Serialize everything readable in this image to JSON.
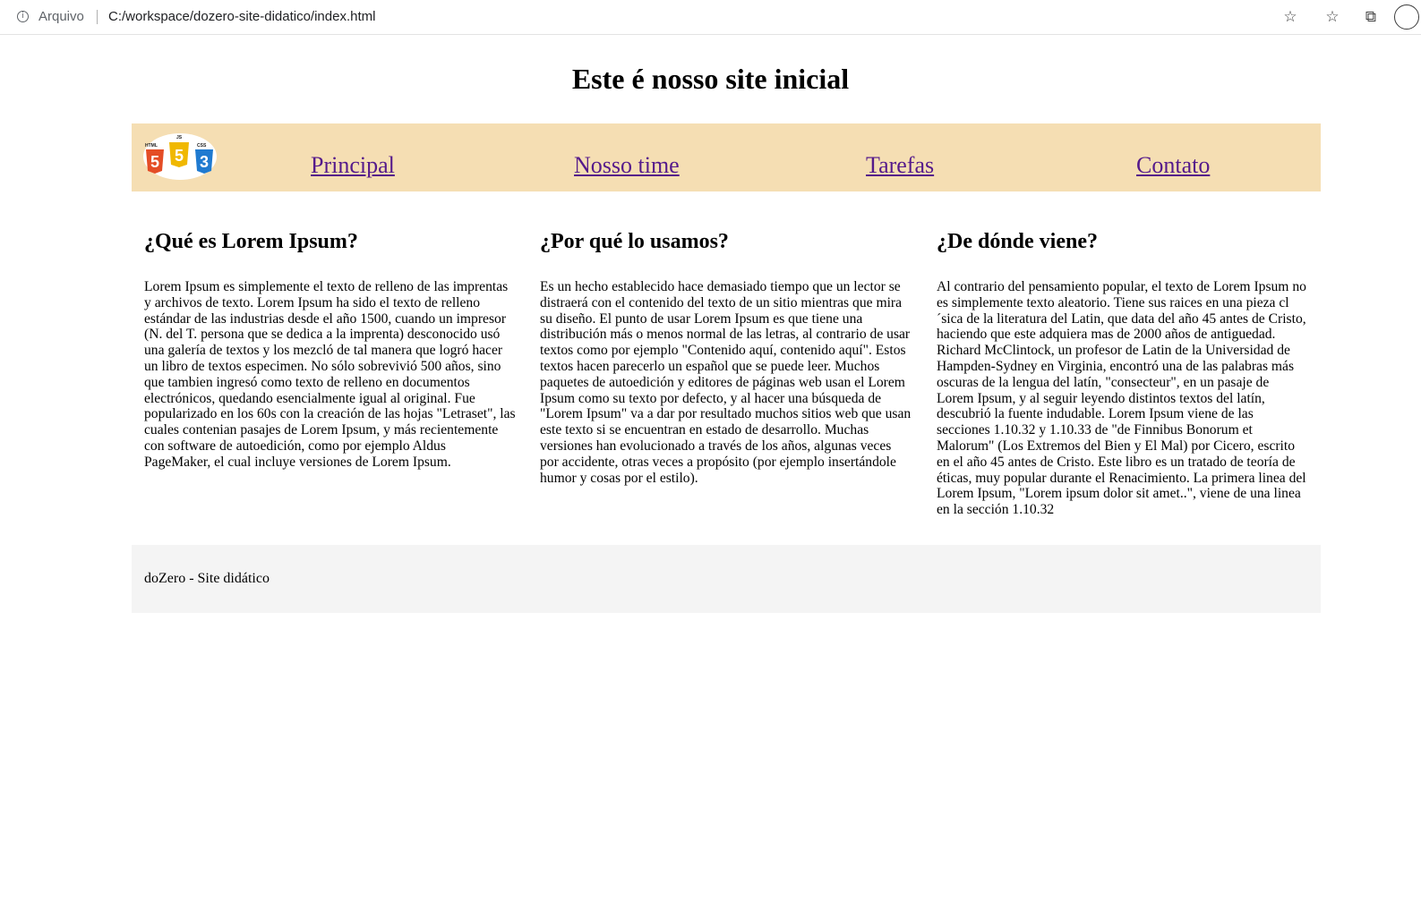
{
  "browser": {
    "protocol_label": "Arquivo",
    "url": "C:/workspace/dozero-site-didatico/index.html",
    "icons": {
      "info": "info-icon",
      "add_favorite": "star-add-icon",
      "favorites": "favorites-icon",
      "collections": "collections-icon",
      "profile": "profile-icon"
    }
  },
  "page": {
    "title": "Este é nosso site inicial",
    "logo": {
      "html": "HTML",
      "js": "JS",
      "css": "CSS",
      "html_num": "5",
      "js_num": "5",
      "css_num": "3"
    },
    "nav": [
      "Principal",
      "Nosso time",
      "Tarefas",
      "Contato"
    ],
    "colors": {
      "nav_bg": "#f5deb3",
      "footer_bg": "#f4f4f4",
      "link": "#551a8b"
    },
    "columns": [
      {
        "heading": "¿Qué es Lorem Ipsum?",
        "text": "Lorem Ipsum es simplemente el texto de relleno de las imprentas y archivos de texto. Lorem Ipsum ha sido el texto de relleno estándar de las industrias desde el año 1500, cuando un impresor (N. del T. persona que se dedica a la imprenta) desconocido usó una galería de textos y los mezcló de tal manera que logró hacer un libro de textos especimen. No sólo sobrevivió 500 años, sino que tambien ingresó como texto de relleno en documentos electrónicos, quedando esencialmente igual al original. Fue popularizado en los 60s con la creación de las hojas \"Letraset\", las cuales contenian pasajes de Lorem Ipsum, y más recientemente con software de autoedición, como por ejemplo Aldus PageMaker, el cual incluye versiones de Lorem Ipsum."
      },
      {
        "heading": "¿Por qué lo usamos?",
        "text": "Es un hecho establecido hace demasiado tiempo que un lector se distraerá con el contenido del texto de un sitio mientras que mira su diseño. El punto de usar Lorem Ipsum es que tiene una distribución más o menos normal de las letras, al contrario de usar textos como por ejemplo \"Contenido aquí, contenido aquí\". Estos textos hacen parecerlo un español que se puede leer. Muchos paquetes de autoedición y editores de páginas web usan el Lorem Ipsum como su texto por defecto, y al hacer una búsqueda de \"Lorem Ipsum\" va a dar por resultado muchos sitios web que usan este texto si se encuentran en estado de desarrollo. Muchas versiones han evolucionado a través de los años, algunas veces por accidente, otras veces a propósito (por ejemplo insertándole humor y cosas por el estilo)."
      },
      {
        "heading": "¿De dónde viene?",
        "text": "Al contrario del pensamiento popular, el texto de Lorem Ipsum no es simplemente texto aleatorio. Tiene sus raices en una pieza cl´sica de la literatura del Latin, que data del año 45 antes de Cristo, haciendo que este adquiera mas de 2000 años de antiguedad. Richard McClintock, un profesor de Latin de la Universidad de Hampden-Sydney en Virginia, encontró una de las palabras más oscuras de la lengua del latín, \"consecteur\", en un pasaje de Lorem Ipsum, y al seguir leyendo distintos textos del latín, descubrió la fuente indudable. Lorem Ipsum viene de las secciones 1.10.32 y 1.10.33 de \"de Finnibus Bonorum et Malorum\" (Los Extremos del Bien y El Mal) por Cicero, escrito en el año 45 antes de Cristo. Este libro es un tratado de teoría de éticas, muy popular durante el Renacimiento. La primera linea del Lorem Ipsum, \"Lorem ipsum dolor sit amet..\", viene de una linea en la sección 1.10.32"
      }
    ],
    "footer": "doZero - Site didático"
  }
}
